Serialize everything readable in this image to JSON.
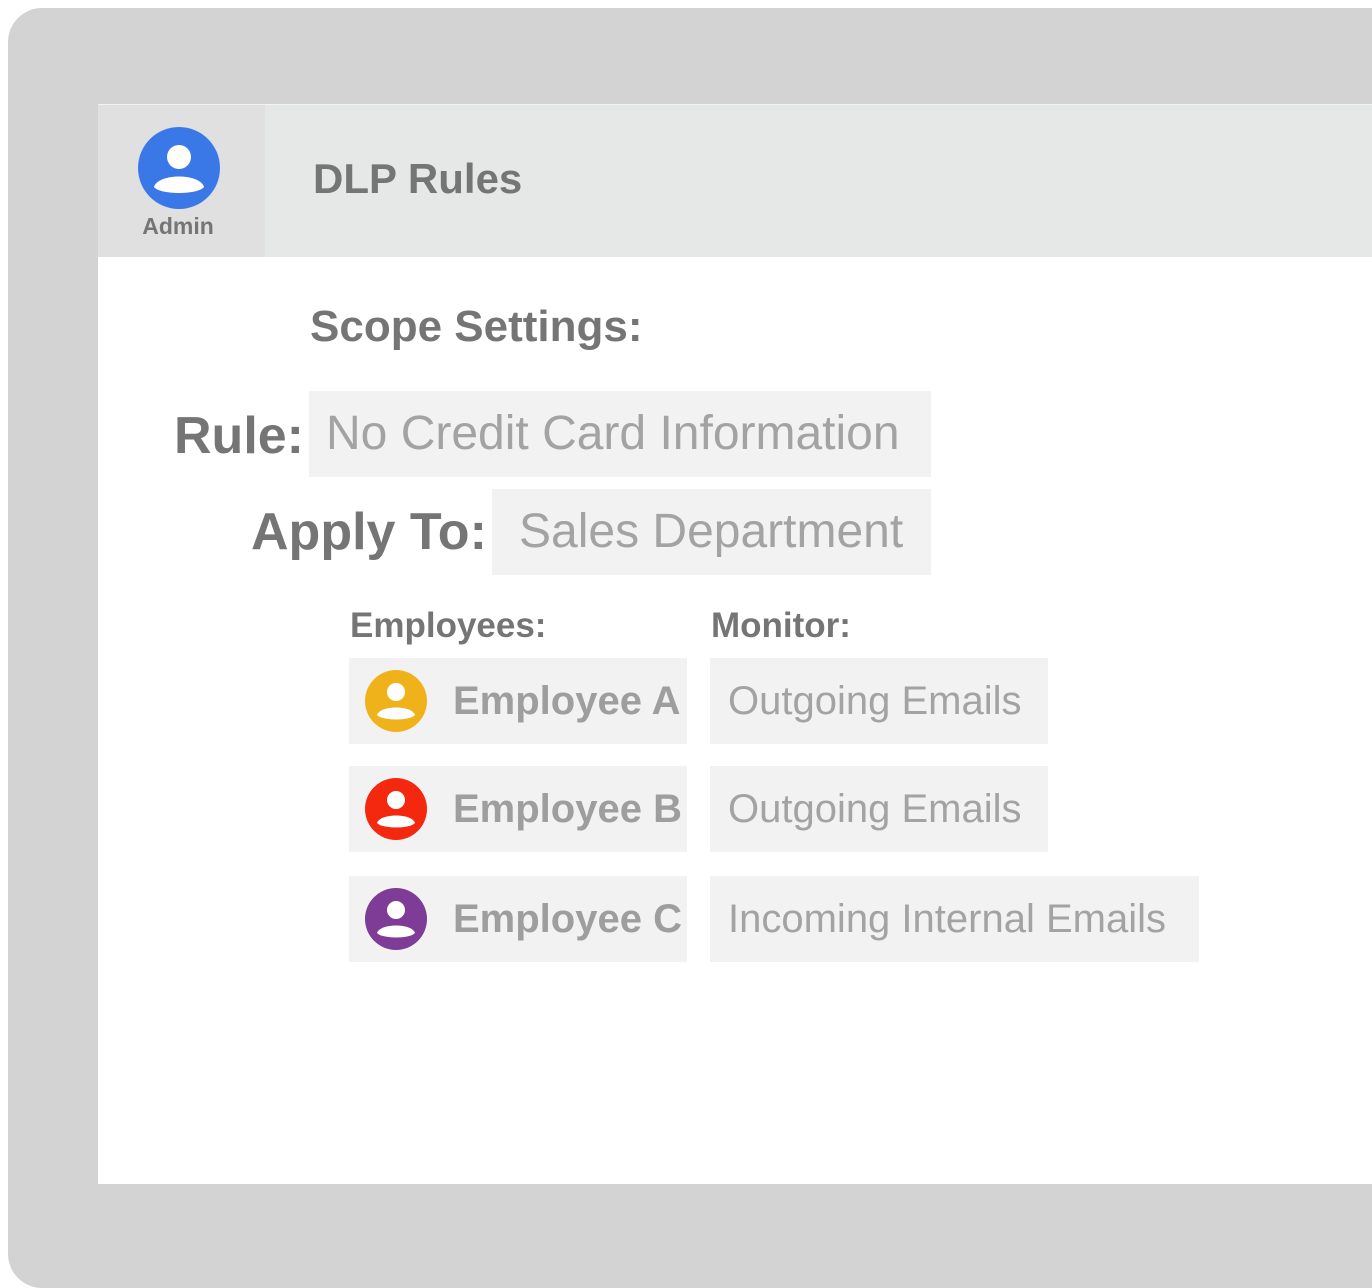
{
  "header": {
    "admin_label": "Admin",
    "title": "DLP Rules"
  },
  "scope": {
    "section_title": "Scope Settings:",
    "rule_label": "Rule:",
    "rule_value": "No Credit Card Information",
    "apply_label": "Apply To:",
    "apply_value": "Sales Department"
  },
  "table": {
    "employees_header": "Employees:",
    "monitor_header": "Monitor:",
    "rows": [
      {
        "name": "Employee A",
        "monitor": "Outgoing Emails",
        "avatar_color": "#f0b21b"
      },
      {
        "name": "Employee B",
        "monitor": "Outgoing Emails",
        "avatar_color": "#f4280f"
      },
      {
        "name": "Employee C",
        "monitor": "Incoming Internal Emails",
        "avatar_color": "#7e3c96"
      }
    ]
  },
  "colors": {
    "admin_avatar": "#3b78e7",
    "bezel": "#d3d3d4",
    "label_text": "#757575",
    "field_bg": "#f2f2f2",
    "field_text": "#a3a3a3"
  },
  "icons": {
    "admin": "user-avatar-icon",
    "employee": "user-avatar-icon"
  }
}
